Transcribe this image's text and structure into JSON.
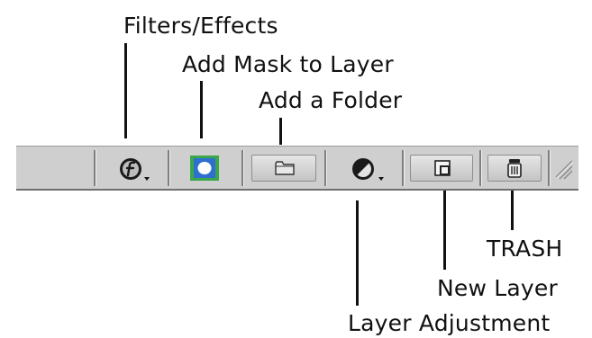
{
  "callouts": {
    "filters_effects": "Filters/Effects",
    "add_mask": "Add Mask to Layer",
    "add_folder": "Add a Folder",
    "trash": "TRASH",
    "new_layer": "New Layer",
    "layer_adjustment": "Layer Adjustment"
  },
  "toolbar": {
    "buttons": [
      {
        "name": "filters-effects",
        "icon": "f-circle-icon",
        "has_menu": true
      },
      {
        "name": "add-mask",
        "icon": "mask-icon",
        "accent": "#3aa84a"
      },
      {
        "name": "add-folder",
        "icon": "folder-icon"
      },
      {
        "name": "layer-adjustment",
        "icon": "half-circle-icon",
        "has_menu": true
      },
      {
        "name": "new-layer",
        "icon": "new-layer-icon"
      },
      {
        "name": "trash",
        "icon": "trash-icon"
      },
      {
        "name": "resize-grip",
        "icon": "grip-icon"
      }
    ]
  },
  "colors": {
    "toolbar_bg": "#cfcfcf",
    "mask_highlight": "#3aa84a",
    "mask_blue": "#2f6fd0"
  }
}
